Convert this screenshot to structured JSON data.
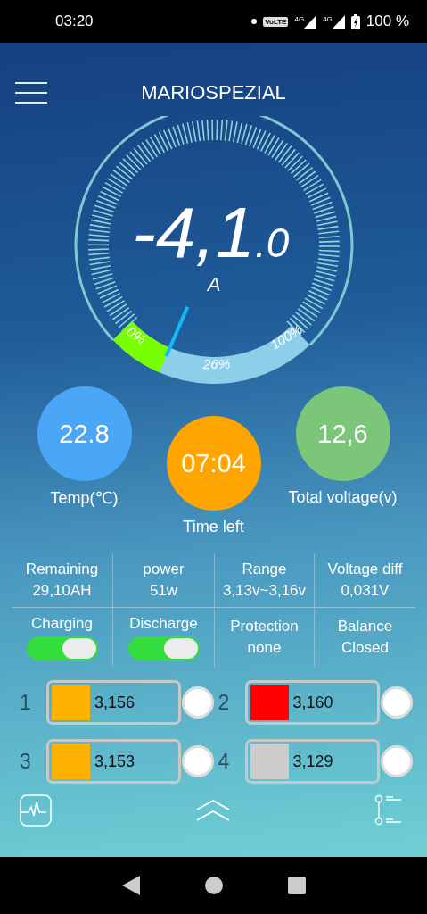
{
  "status_bar": {
    "time": "03:20",
    "volte": "VoLTE",
    "signal_1": "4G",
    "signal_2": "4G",
    "battery": "100 %"
  },
  "header": {
    "title": "MARIOSPEZIAL"
  },
  "gauge": {
    "value": "-4,1",
    "decimal": ".0",
    "unit": "A",
    "labels": [
      "0%",
      "26%",
      "100%"
    ]
  },
  "stats": [
    {
      "value": "22.8",
      "label": "Temp(℃)",
      "color": "#4aa6f7"
    },
    {
      "value": "07:04",
      "label": "Time left",
      "color": "#ffa500"
    },
    {
      "value": "12,6",
      "label": "Total voltage(v)",
      "color": "#7cc67a"
    }
  ],
  "info": [
    {
      "label": "Remaining",
      "value": "29,10AH"
    },
    {
      "label": "power",
      "value": "51w"
    },
    {
      "label": "Range",
      "value": "3,13v~3,16v"
    },
    {
      "label": "Voltage diff",
      "value": "0,031V"
    }
  ],
  "controls": [
    {
      "kind": "switch",
      "label": "Charging",
      "on": true
    },
    {
      "kind": "switch",
      "label": "Discharge",
      "on": true
    },
    {
      "kind": "text",
      "label": "Protection",
      "value": "none"
    },
    {
      "kind": "text",
      "label": "Balance",
      "value": "Closed"
    }
  ],
  "cells": [
    {
      "index": "1",
      "voltage": "3,156",
      "color": "#ffb300"
    },
    {
      "index": "2",
      "voltage": "3,160",
      "color": "#ff0000"
    },
    {
      "index": "3",
      "voltage": "3,153",
      "color": "#ffb300"
    },
    {
      "index": "4",
      "voltage": "3,129",
      "color": "#cccccc"
    }
  ]
}
